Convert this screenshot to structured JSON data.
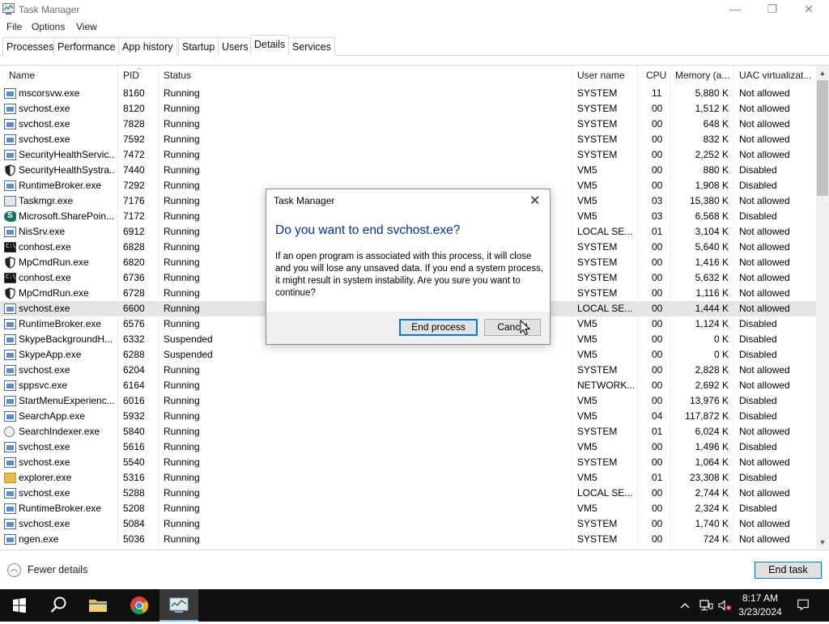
{
  "window": {
    "title": "Task Manager",
    "controls": [
      "—",
      "❐",
      "✕"
    ]
  },
  "menu": [
    "File",
    "Options",
    "View"
  ],
  "tabs": [
    "Processes",
    "Performance",
    "App history",
    "Startup",
    "Users",
    "Details",
    "Services"
  ],
  "active_tab": "Details",
  "columns": {
    "name": "Name",
    "pid": "PID",
    "status": "Status",
    "user": "User name",
    "cpu": "CPU",
    "memory": "Memory (a...",
    "uac": "UAC virtualizat..."
  },
  "processes": [
    {
      "icon": "exe-icon",
      "name": "mscorsvw.exe",
      "pid": "8160",
      "status": "Running",
      "user": "SYSTEM",
      "cpu": "11",
      "memory": "5,880 K",
      "uac": "Not allowed"
    },
    {
      "icon": "exe-icon",
      "name": "svchost.exe",
      "pid": "8120",
      "status": "Running",
      "user": "SYSTEM",
      "cpu": "00",
      "memory": "1,512 K",
      "uac": "Not allowed"
    },
    {
      "icon": "exe-icon",
      "name": "svchost.exe",
      "pid": "7828",
      "status": "Running",
      "user": "SYSTEM",
      "cpu": "00",
      "memory": "648 K",
      "uac": "Not allowed"
    },
    {
      "icon": "exe-icon",
      "name": "svchost.exe",
      "pid": "7592",
      "status": "Running",
      "user": "SYSTEM",
      "cpu": "00",
      "memory": "832 K",
      "uac": "Not allowed"
    },
    {
      "icon": "exe-icon",
      "name": "SecurityHealthServic...",
      "pid": "7472",
      "status": "Running",
      "user": "SYSTEM",
      "cpu": "00",
      "memory": "2,252 K",
      "uac": "Not allowed"
    },
    {
      "icon": "shield-icon",
      "name": "SecurityHealthSystra...",
      "pid": "7440",
      "status": "Running",
      "user": "VM5",
      "cpu": "00",
      "memory": "880 K",
      "uac": "Disabled"
    },
    {
      "icon": "exe-icon",
      "name": "RuntimeBroker.exe",
      "pid": "7292",
      "status": "Running",
      "user": "VM5",
      "cpu": "00",
      "memory": "1,908 K",
      "uac": "Disabled"
    },
    {
      "icon": "taskmgr-icon",
      "name": "Taskmgr.exe",
      "pid": "7176",
      "status": "Running",
      "user": "VM5",
      "cpu": "03",
      "memory": "15,380 K",
      "uac": "Not allowed"
    },
    {
      "icon": "sharepoint-icon",
      "name": "Microsoft.SharePoin...",
      "pid": "7172",
      "status": "Running",
      "user": "VM5",
      "cpu": "03",
      "memory": "6,568 K",
      "uac": "Disabled"
    },
    {
      "icon": "exe-icon",
      "name": "NisSrv.exe",
      "pid": "6912",
      "status": "Running",
      "user": "LOCAL SE...",
      "cpu": "01",
      "memory": "3,104 K",
      "uac": "Not allowed"
    },
    {
      "icon": "cmd-icon",
      "name": "conhost.exe",
      "pid": "6828",
      "status": "Running",
      "user": "SYSTEM",
      "cpu": "00",
      "memory": "5,640 K",
      "uac": "Not allowed"
    },
    {
      "icon": "shield-icon",
      "name": "MpCmdRun.exe",
      "pid": "6820",
      "status": "Running",
      "user": "SYSTEM",
      "cpu": "00",
      "memory": "1,416 K",
      "uac": "Not allowed"
    },
    {
      "icon": "cmd-icon",
      "name": "conhost.exe",
      "pid": "6736",
      "status": "Running",
      "user": "SYSTEM",
      "cpu": "00",
      "memory": "5,632 K",
      "uac": "Not allowed"
    },
    {
      "icon": "shield-icon",
      "name": "MpCmdRun.exe",
      "pid": "6728",
      "status": "Running",
      "user": "SYSTEM",
      "cpu": "00",
      "memory": "1,116 K",
      "uac": "Not allowed"
    },
    {
      "icon": "exe-icon",
      "name": "svchost.exe",
      "pid": "6600",
      "status": "Running",
      "user": "LOCAL SE...",
      "cpu": "00",
      "memory": "1,444 K",
      "uac": "Not allowed",
      "selected": true
    },
    {
      "icon": "exe-icon",
      "name": "RuntimeBroker.exe",
      "pid": "6576",
      "status": "Running",
      "user": "VM5",
      "cpu": "00",
      "memory": "1,124 K",
      "uac": "Disabled"
    },
    {
      "icon": "exe-icon",
      "name": "SkypeBackgroundH...",
      "pid": "6332",
      "status": "Suspended",
      "user": "VM5",
      "cpu": "00",
      "memory": "0 K",
      "uac": "Disabled"
    },
    {
      "icon": "exe-icon",
      "name": "SkypeApp.exe",
      "pid": "6288",
      "status": "Suspended",
      "user": "VM5",
      "cpu": "00",
      "memory": "0 K",
      "uac": "Disabled"
    },
    {
      "icon": "exe-icon",
      "name": "svchost.exe",
      "pid": "6204",
      "status": "Running",
      "user": "SYSTEM",
      "cpu": "00",
      "memory": "2,828 K",
      "uac": "Not allowed"
    },
    {
      "icon": "exe-icon",
      "name": "sppsvc.exe",
      "pid": "6164",
      "status": "Running",
      "user": "NETWORK...",
      "cpu": "00",
      "memory": "2,692 K",
      "uac": "Not allowed"
    },
    {
      "icon": "exe-icon",
      "name": "StartMenuExperienc...",
      "pid": "6016",
      "status": "Running",
      "user": "VM5",
      "cpu": "00",
      "memory": "13,976 K",
      "uac": "Disabled"
    },
    {
      "icon": "exe-icon",
      "name": "SearchApp.exe",
      "pid": "5932",
      "status": "Running",
      "user": "VM5",
      "cpu": "04",
      "memory": "117,872 K",
      "uac": "Disabled"
    },
    {
      "icon": "search-indexer-icon",
      "name": "SearchIndexer.exe",
      "pid": "5840",
      "status": "Running",
      "user": "SYSTEM",
      "cpu": "01",
      "memory": "6,024 K",
      "uac": "Not allowed"
    },
    {
      "icon": "exe-icon",
      "name": "svchost.exe",
      "pid": "5616",
      "status": "Running",
      "user": "VM5",
      "cpu": "00",
      "memory": "1,496 K",
      "uac": "Disabled"
    },
    {
      "icon": "exe-icon",
      "name": "svchost.exe",
      "pid": "5540",
      "status": "Running",
      "user": "SYSTEM",
      "cpu": "00",
      "memory": "1,064 K",
      "uac": "Not allowed"
    },
    {
      "icon": "folder-icon",
      "name": "explorer.exe",
      "pid": "5316",
      "status": "Running",
      "user": "VM5",
      "cpu": "01",
      "memory": "23,308 K",
      "uac": "Disabled"
    },
    {
      "icon": "exe-icon",
      "name": "svchost.exe",
      "pid": "5288",
      "status": "Running",
      "user": "LOCAL SE...",
      "cpu": "00",
      "memory": "2,744 K",
      "uac": "Not allowed"
    },
    {
      "icon": "exe-icon",
      "name": "RuntimeBroker.exe",
      "pid": "5208",
      "status": "Running",
      "user": "VM5",
      "cpu": "00",
      "memory": "2,324 K",
      "uac": "Disabled"
    },
    {
      "icon": "exe-icon",
      "name": "svchost.exe",
      "pid": "5084",
      "status": "Running",
      "user": "SYSTEM",
      "cpu": "00",
      "memory": "1,740 K",
      "uac": "Not allowed"
    },
    {
      "icon": "exe-icon",
      "name": "ngen.exe",
      "pid": "5036",
      "status": "Running",
      "user": "SYSTEM",
      "cpu": "00",
      "memory": "724 K",
      "uac": "Not allowed"
    }
  ],
  "footer": {
    "fewer_details": "Fewer details",
    "end_task": "End task"
  },
  "dialog": {
    "title": "Task Manager",
    "heading": "Do you want to end svchost.exe?",
    "body": "If an open program is associated with this process, it will close and you will lose any unsaved data. If you end a system process, it might result in system instability. Are you sure you want to continue?",
    "end_process": "End process",
    "cancel": "Cancel"
  },
  "taskbar": {
    "time": "8:17 AM",
    "date": "3/23/2024"
  },
  "colors": {
    "accent": "#0078d7",
    "heading_blue": "#003399",
    "taskbar": "#101010",
    "selected_row": "#e5e5e5"
  }
}
